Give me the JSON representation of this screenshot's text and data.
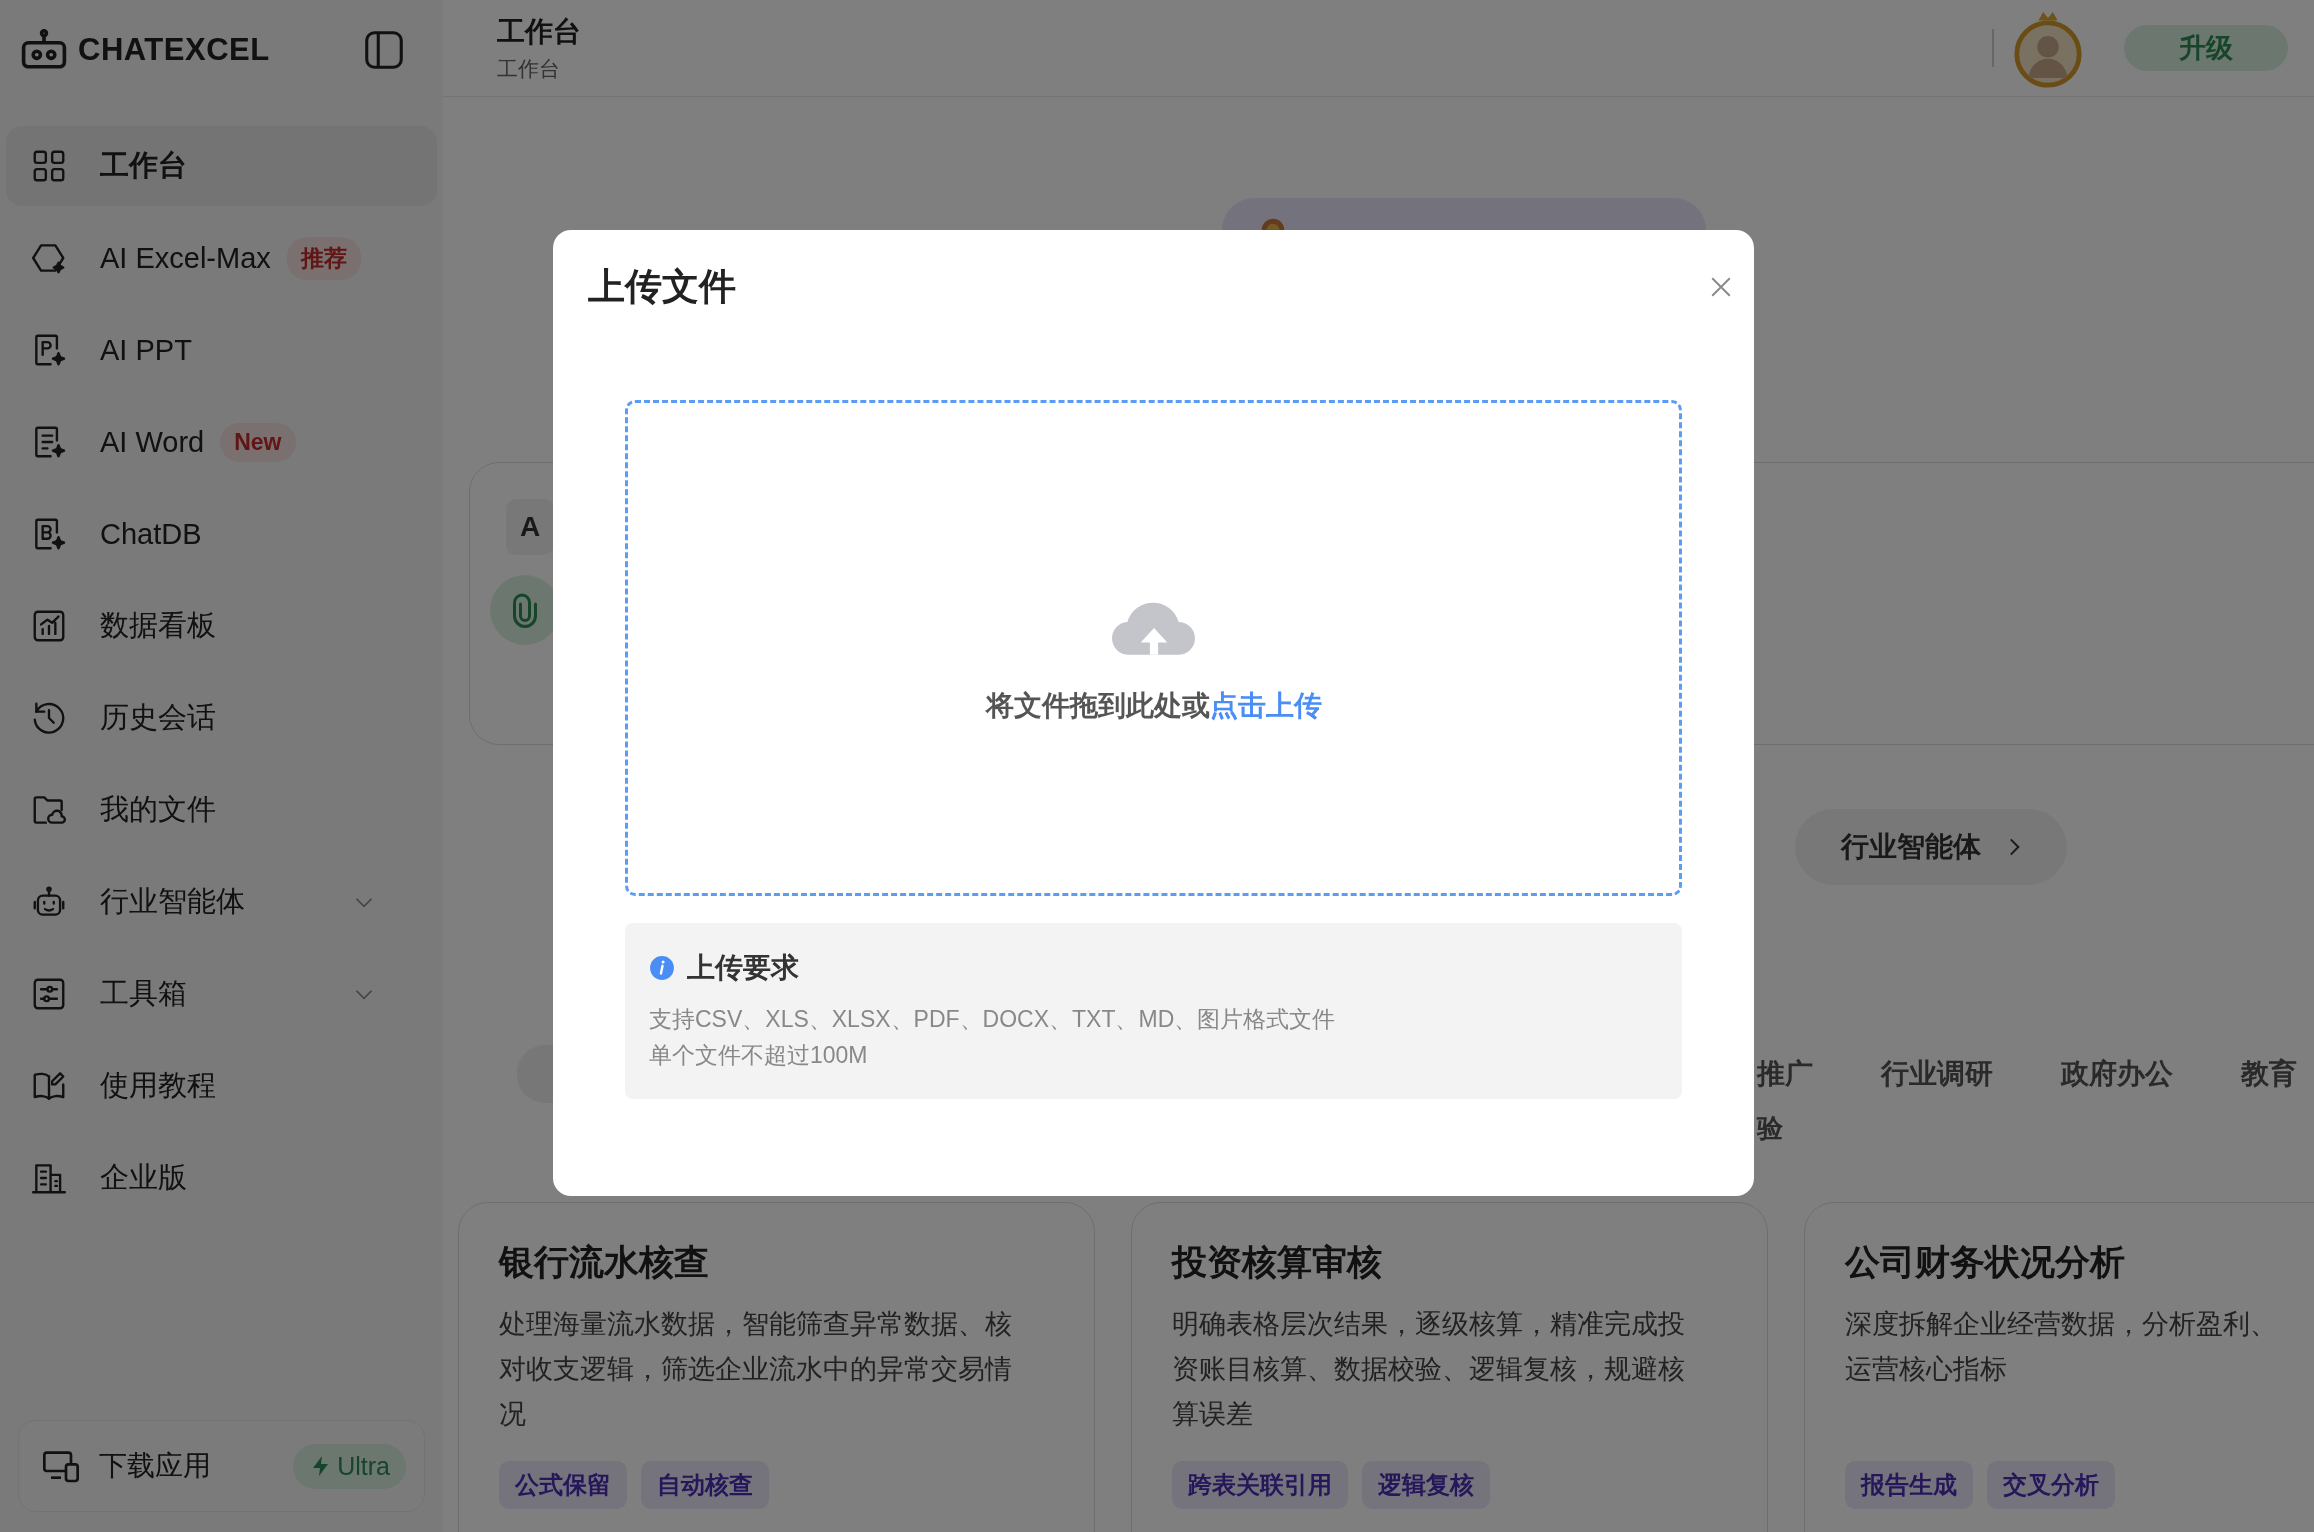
{
  "sidebar": {
    "logo": "CHATEXCEL",
    "items": [
      {
        "label": "工作台",
        "selected": true
      },
      {
        "label": "AI Excel-Max",
        "selected": false,
        "badge": "推荐"
      },
      {
        "label": "AI PPT",
        "selected": false
      },
      {
        "label": "AI Word",
        "selected": false,
        "badge": "New"
      },
      {
        "label": "ChatDB",
        "selected": false
      },
      {
        "label": "数据看板",
        "selected": false
      },
      {
        "label": "历史会话",
        "selected": false
      },
      {
        "label": "我的文件",
        "selected": false
      },
      {
        "label": "行业智能体",
        "selected": false,
        "expanded": false
      },
      {
        "label": "工具箱",
        "selected": false,
        "expanded": false
      },
      {
        "label": "使用教程",
        "selected": false
      },
      {
        "label": "企业版",
        "selected": false
      }
    ],
    "download": {
      "label": "下载应用",
      "badge": "Ultra"
    }
  },
  "header": {
    "title": "工作台",
    "subtitle": "工作台",
    "upgrade_button": "升级"
  },
  "banner": {
    "kind": "promo"
  },
  "input_card": {
    "chip": "A"
  },
  "industry_button": "行业智能体",
  "tabs": [
    {
      "selected": true
    },
    {
      "label": "推广",
      "selected": false
    },
    {
      "label": "行业调研",
      "selected": false
    },
    {
      "label": "政府办公",
      "selected": false
    },
    {
      "label": "教育",
      "selected": false
    }
  ],
  "fragment": "验",
  "cards": [
    {
      "title": "银行流水核查",
      "desc_lines": [
        "处理海量流水数据，智能筛查异常数据、核",
        "对收支逻辑，筛选企业流水中的异常交易情",
        "况"
      ],
      "tags": [
        "公式保留",
        "自动核查"
      ]
    },
    {
      "title": "投资核算审核",
      "desc_lines": [
        "明确表格层次结果，逐级核算，精准完成投",
        "资账目核算、数据校验、逻辑复核，规避核",
        "算误差"
      ],
      "tags": [
        "跨表关联引用",
        "逻辑复核"
      ]
    },
    {
      "title": "公司财务状况分析",
      "desc_lines": [
        "深度拆解企业经营数据，分析盈利、",
        "运营核心指标"
      ],
      "tags": [
        "报告生成",
        "交叉分析"
      ]
    }
  ],
  "modal": {
    "title": "上传文件",
    "drop_text": "将文件拖到此处或",
    "drop_link": "点击上传",
    "requirements": {
      "title": "上传要求",
      "lines": [
        "支持CSV、XLS、XLSX、PDF、DOCX、TXT、MD、图片格式文件",
        "单个文件不超过100M"
      ]
    }
  }
}
